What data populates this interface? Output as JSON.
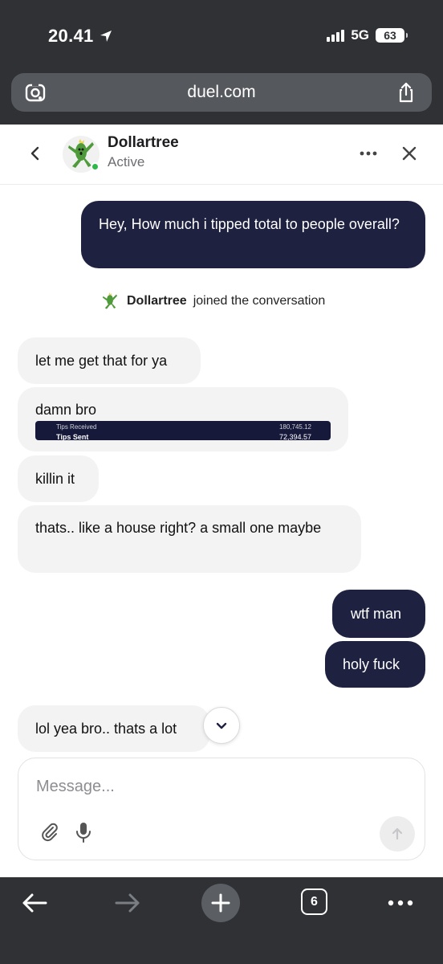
{
  "status_bar": {
    "time": "20.41",
    "network": "5G",
    "battery": "63"
  },
  "browser": {
    "url": "duel.com",
    "tab_count": "6"
  },
  "chat": {
    "contact_name": "Dollartree",
    "contact_status": "Active",
    "system_note": {
      "name": "Dollartree",
      "text": "joined the conversation"
    },
    "messages": [
      {
        "direction": "out",
        "text": "Hey, How much i tipped total to people overall?"
      },
      {
        "direction": "in",
        "text": "let me get that for ya"
      },
      {
        "direction": "in",
        "text": "damn bro"
      },
      {
        "direction": "in",
        "text": "killin it"
      },
      {
        "direction": "in",
        "text": "thats.. like a house right? a small one maybe"
      },
      {
        "direction": "out",
        "text": "wtf man"
      },
      {
        "direction": "out",
        "text": "holy fuck"
      },
      {
        "direction": "in",
        "text": "lol yea bro.. thats a lot"
      }
    ],
    "tips_card": {
      "cut_label": "Tips Received",
      "cut_value": "180,745.12",
      "label": "Tips Sent",
      "value": "72,394.57"
    }
  },
  "composer": {
    "placeholder": "Message..."
  },
  "colors": {
    "outgoing_bubble": "#1e2140",
    "incoming_bubble": "#f3f3f4",
    "online": "#2db84b",
    "chrome": "#2f3135"
  },
  "icons": [
    "location-arrow-icon",
    "lens-icon",
    "share-icon",
    "chevron-left-icon",
    "cactuar-avatar-icon",
    "ellipsis-icon",
    "close-icon",
    "chevron-down-icon",
    "paperclip-icon",
    "microphone-icon",
    "arrow-up-icon",
    "arrow-left-icon",
    "arrow-right-icon",
    "plus-icon"
  ]
}
